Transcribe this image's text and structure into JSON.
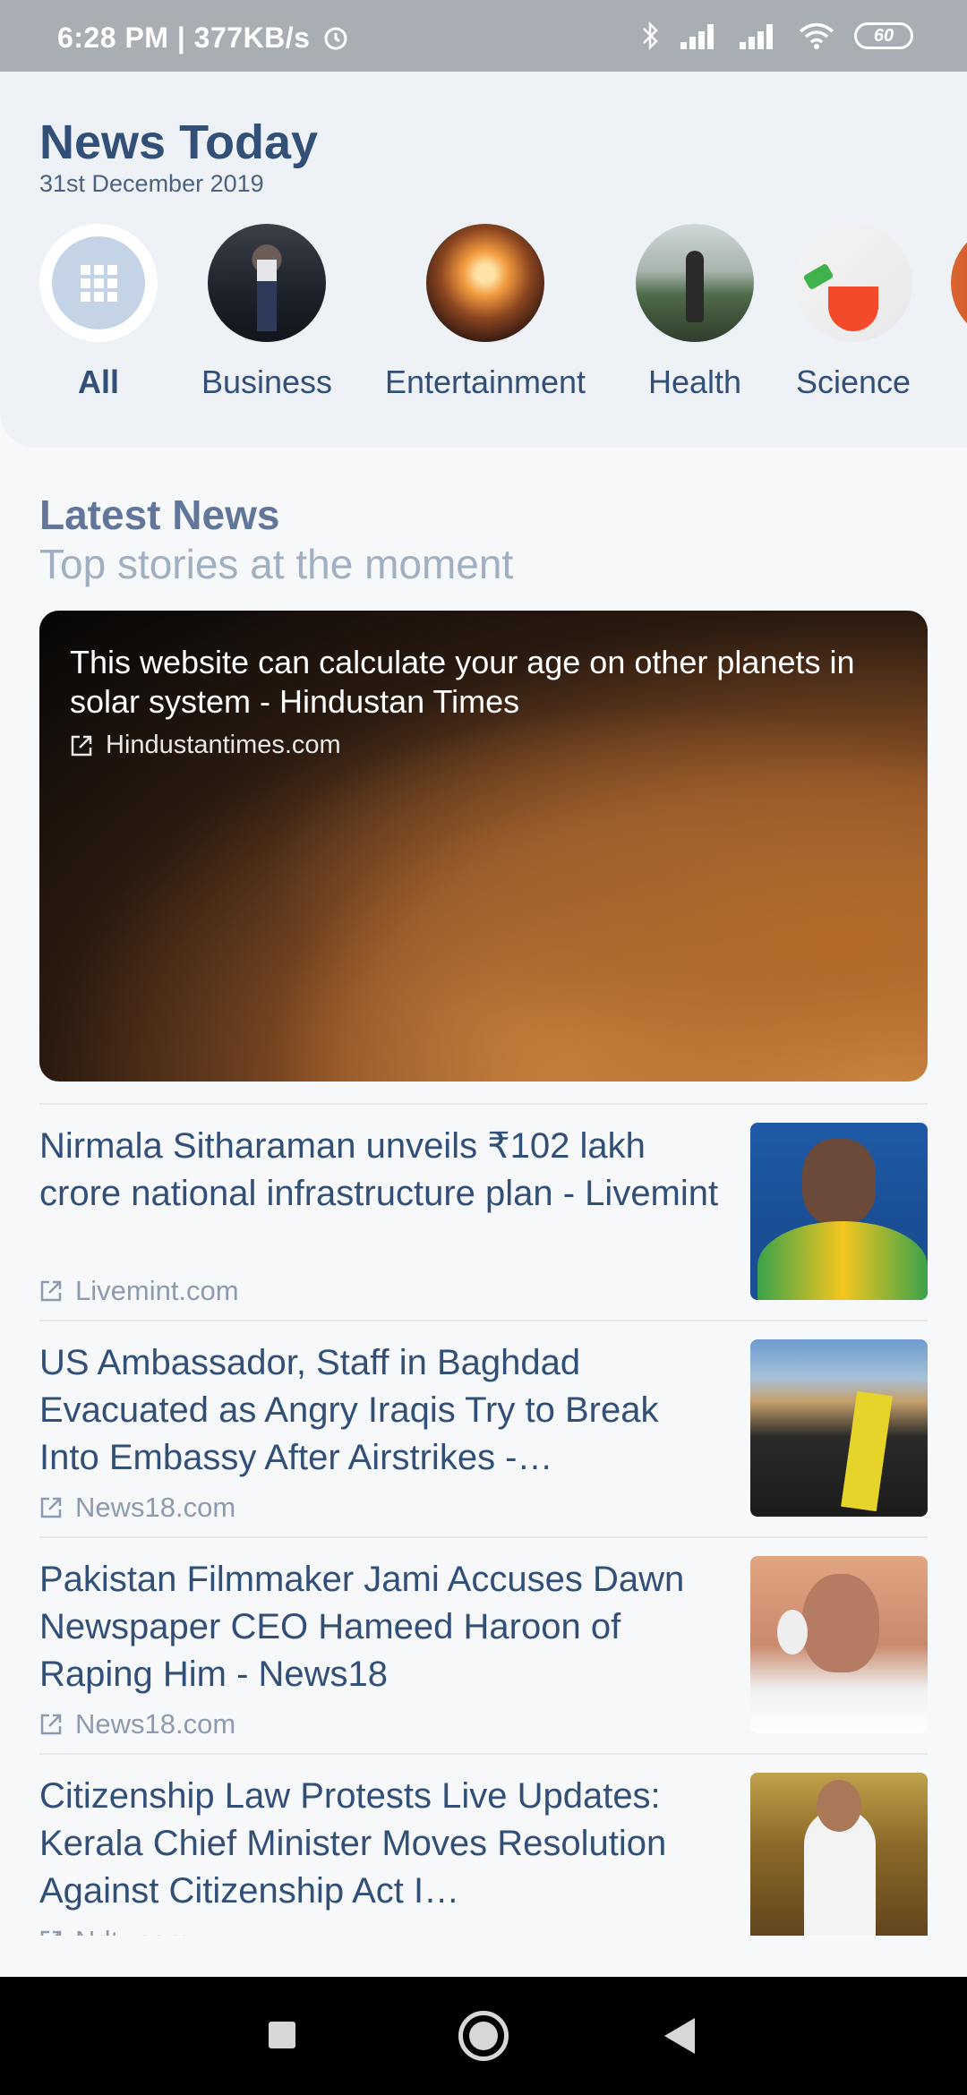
{
  "status_bar": {
    "time": "6:28 PM",
    "speed": "377KB/s",
    "battery": "60",
    "icons": [
      "alarm-icon",
      "bluetooth-icon",
      "signal-icon",
      "signal-icon",
      "wifi-icon",
      "battery-icon"
    ]
  },
  "header": {
    "title": "News Today",
    "date": "31st December 2019"
  },
  "categories": [
    {
      "label": "All",
      "selected": true,
      "icon": "grid-icon"
    },
    {
      "label": "Business",
      "selected": false
    },
    {
      "label": "Entertainment",
      "selected": false
    },
    {
      "label": "Health",
      "selected": false
    },
    {
      "label": "Science",
      "selected": false
    }
  ],
  "latest": {
    "title": "Latest News",
    "subtitle": "Top stories at the moment"
  },
  "featured": {
    "title": "This website can calculate your age on other planets in solar system - Hindustan Times",
    "source": "Hindustantimes.com",
    "icon": "external-link-icon"
  },
  "news": [
    {
      "title": "Nirmala Sitharaman unveils ₹102 lakh crore national infrastructure plan - Livemint",
      "source": "Livemint.com"
    },
    {
      "title": "US Ambassador, Staff in Baghdad Evacuated as Angry Iraqis Try to Break Into Embassy After Airstrikes -…",
      "source": "News18.com"
    },
    {
      "title": "Pakistan Filmmaker Jami Accuses Dawn Newspaper CEO Hameed Haroon of Raping Him - News18",
      "source": "News18.com"
    },
    {
      "title": "Citizenship Law Protests Live Updates: Kerala Chief Minister Moves Resolution Against Citizenship Act I…",
      "source": "Ndtv.com"
    }
  ],
  "colors": {
    "primary": "#324f77",
    "secondary": "#61769a",
    "muted": "#a1afc3",
    "header_bg": "#eef1f6"
  }
}
